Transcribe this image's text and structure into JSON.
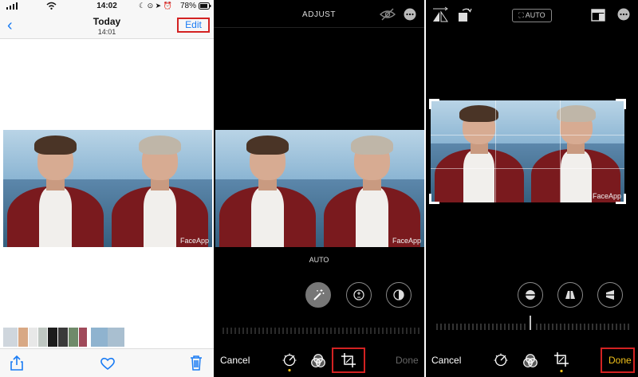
{
  "panel1": {
    "status": {
      "time": "14:02",
      "battery": "78%"
    },
    "header": {
      "title": "Today",
      "subtitle": "14:01",
      "edit_label": "Edit"
    },
    "photo": {
      "watermark": "FaceApp"
    }
  },
  "panel2": {
    "title": "ADJUST",
    "photo": {
      "watermark": "FaceApp"
    },
    "auto_label": "AUTO",
    "cancel_label": "Cancel",
    "done_label": "Done"
  },
  "panel3": {
    "auto_badge": "AUTO",
    "photo": {
      "watermark": "FaceApp"
    },
    "cancel_label": "Cancel",
    "done_label": "Done"
  },
  "colors": {
    "ios_blue": "#1a7cf4",
    "highlight_red": "#d32222",
    "done_yellow": "#f2c21a",
    "inactive_gray": "#666"
  },
  "icons": [
    "back-chevron-icon",
    "share-icon",
    "heart-icon",
    "trash-icon",
    "hide-icon",
    "more-icon",
    "magic-wand-icon",
    "exposure-icon",
    "brilliance-icon",
    "adjust-dial-icon",
    "filters-icon",
    "crop-icon",
    "flip-icon",
    "rotate-icon",
    "aspect-ratio-icon",
    "straighten-icon",
    "vertical-perspective-icon",
    "horizontal-perspective-icon"
  ]
}
